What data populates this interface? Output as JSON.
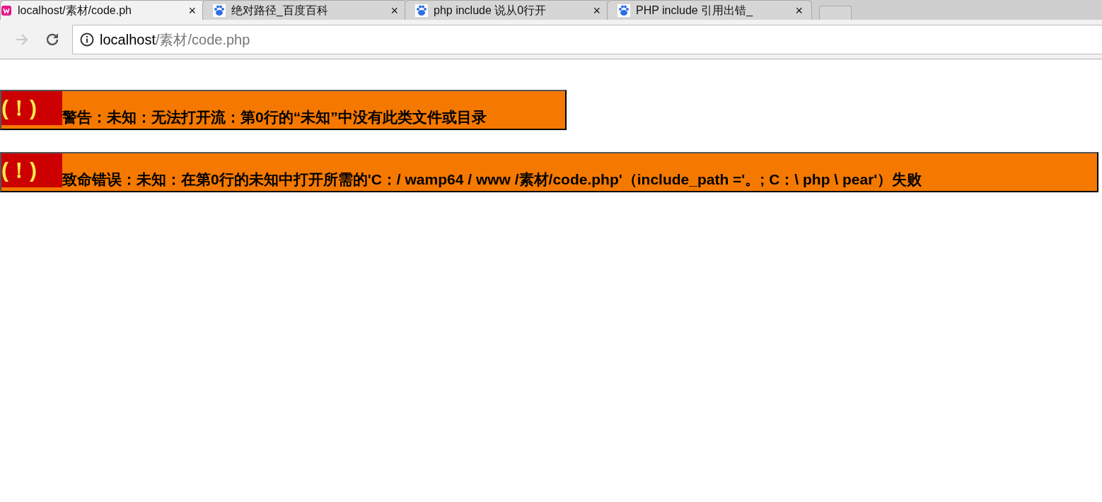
{
  "tabs": [
    {
      "kind": "local",
      "title": "localhost/素材/code.ph",
      "close": "×",
      "selected": true
    },
    {
      "kind": "web",
      "title": "绝对路径_百度百科",
      "close": "×",
      "selected": false
    },
    {
      "kind": "web",
      "title": "php include 说从0行开",
      "close": "×",
      "selected": false
    },
    {
      "kind": "web",
      "title": "PHP include 引用出错_",
      "close": "×",
      "selected": false
    }
  ],
  "toolbar": {
    "forward_disabled": true,
    "url_host": "localhost",
    "url_path": "/素材/code.php"
  },
  "errors": [
    {
      "icon": "(！)",
      "message": "警告：未知：无法打开流：第0行的“未知”中没有此类文件或目录",
      "full_width": false
    },
    {
      "icon": "(！)",
      "message": "致命错误：未知：在第0行的未知中打开所需的'C：/ wamp64 / www /素材/code.php'（include_path ='。; C：\\ php \\ pear'）失败",
      "full_width": true
    }
  ]
}
